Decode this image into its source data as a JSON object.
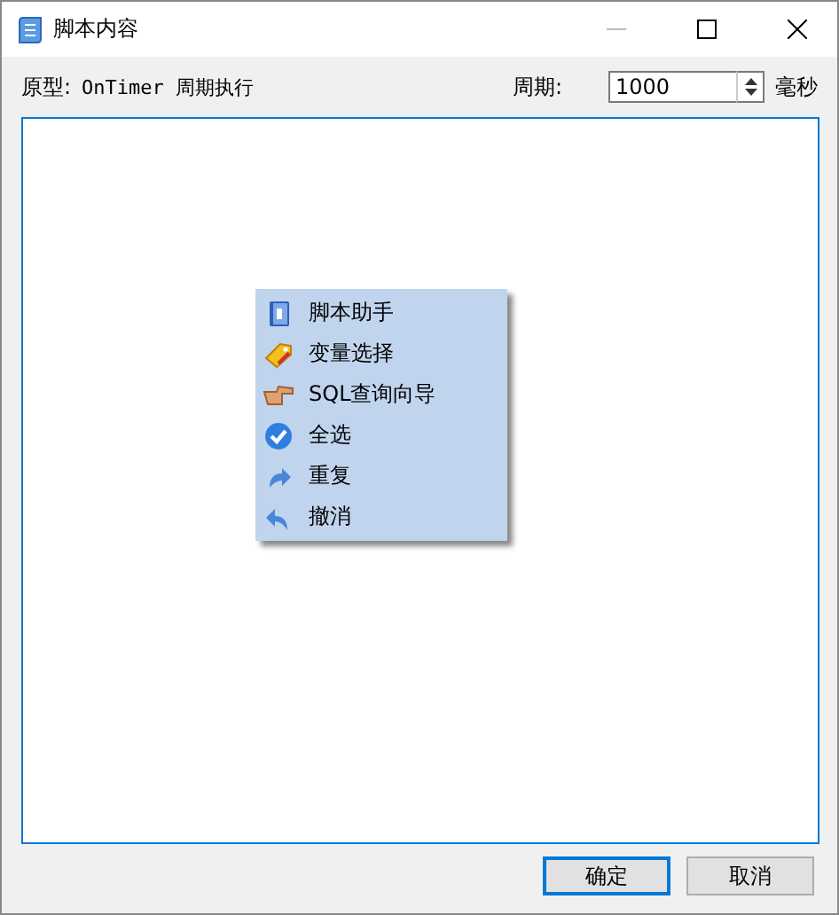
{
  "window": {
    "title": "脚本内容"
  },
  "prototype": {
    "label": "原型:",
    "value": "OnTimer 周期执行"
  },
  "period": {
    "label": "周期:",
    "value": "1000",
    "unit": "毫秒"
  },
  "context_menu": [
    {
      "label": "脚本助手"
    },
    {
      "label": "变量选择"
    },
    {
      "label": "SQL查询向导"
    },
    {
      "label": "全选"
    },
    {
      "label": "重复"
    },
    {
      "label": "撤消"
    }
  ],
  "buttons": [
    {
      "label": "确定",
      "selected": true
    },
    {
      "label": "取消",
      "selected": false
    }
  ]
}
